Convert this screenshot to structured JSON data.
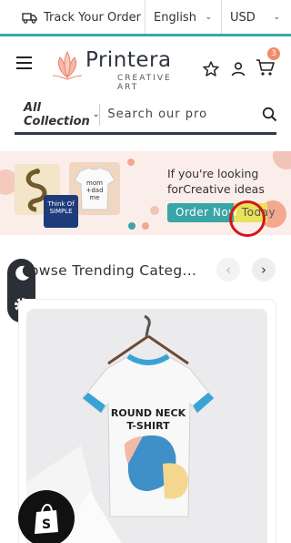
{
  "topbar": {
    "track_label": "Track Your Order",
    "language": "English",
    "currency": "USD"
  },
  "header": {
    "logo_word": "Printera",
    "logo_sub": "CREATIVE ART",
    "cart_count": "3"
  },
  "search": {
    "collection_label": "All Collection",
    "placeholder": "Search our pro"
  },
  "banner": {
    "text_line1": "If you're looking",
    "text_line2": "forCreative ideas",
    "button_label_main": "Order Now ",
    "button_label_tail": "Today",
    "product1_alt": "",
    "product2_text": "mom + dad = me",
    "product3_text": "Think Of SIMPLE"
  },
  "trending": {
    "title": "owse Trending Categ..."
  },
  "product": {
    "shirt_text_line1": "ROUND NECK",
    "shirt_text_line2": "T-SHIRT"
  },
  "colors": {
    "teal": "#3aa5a6",
    "highlight": "#e9e25a",
    "cart_badge": "#f28b6b",
    "cursor_ring": "#d01818"
  }
}
